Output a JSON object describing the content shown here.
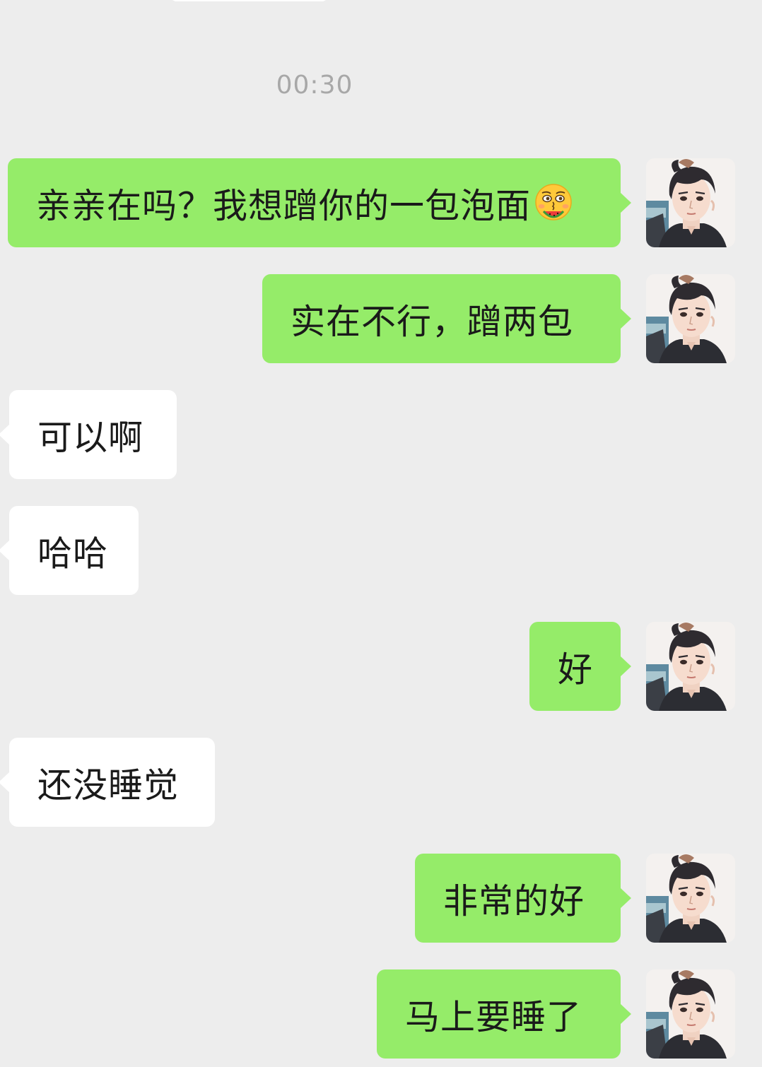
{
  "timestamp": "00:30",
  "messages": [
    {
      "side": "out",
      "text": "亲亲在吗？我想蹭你的一包泡面",
      "emoji": "smiling-face-eating-watermelon-icon"
    },
    {
      "side": "out",
      "text": "实在不行，蹭两包"
    },
    {
      "side": "in",
      "text": "可以啊"
    },
    {
      "side": "in",
      "text": "哈哈"
    },
    {
      "side": "out",
      "text": "好"
    },
    {
      "side": "in",
      "text": "还没睡觉"
    },
    {
      "side": "out",
      "text": "非常的好"
    },
    {
      "side": "out",
      "text": "马上要睡了"
    }
  ],
  "colors": {
    "background": "#ededed",
    "outgoing_bubble": "#95ec69",
    "incoming_bubble": "#ffffff",
    "timestamp_text": "#a8a8a8",
    "message_text": "#1a1a1a"
  },
  "avatar": {
    "icon": "anime-man-avatar-icon"
  }
}
